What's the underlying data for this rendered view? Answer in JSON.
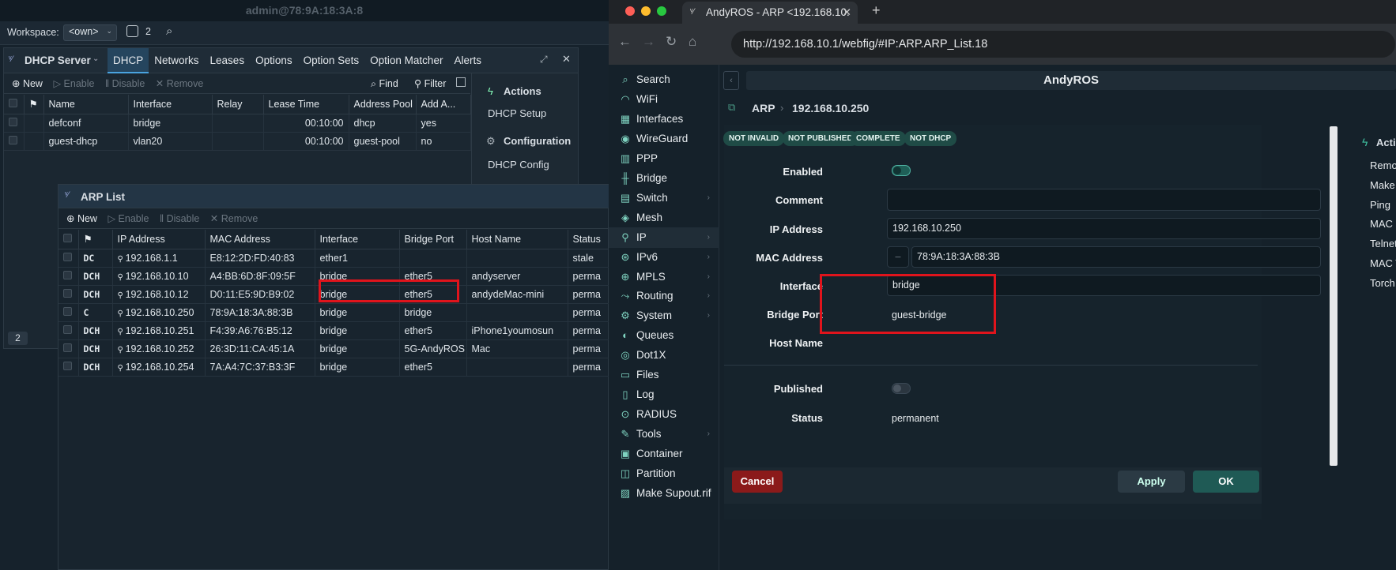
{
  "winbox": {
    "title": "admin@78:9A:18:3A:8",
    "workspace_label": "Workspace:",
    "workspace_value": "<own>",
    "window_count": "2"
  },
  "dhcp": {
    "title": "DHCP Server",
    "tabs": [
      "DHCP",
      "Networks",
      "Leases",
      "Options",
      "Option Sets",
      "Option Matcher",
      "Alerts"
    ],
    "toolbar": {
      "new": "New",
      "enable": "Enable",
      "disable": "Disable",
      "remove": "Remove",
      "find": "Find",
      "filter": "Filter"
    },
    "columns": [
      "Name",
      "Interface",
      "Relay",
      "Lease Time",
      "Address Pool",
      "Add A..."
    ],
    "rows": [
      {
        "name": "defconf",
        "interface": "bridge",
        "relay": "",
        "lease": "00:10:00",
        "pool": "dhcp",
        "add": "yes"
      },
      {
        "name": "guest-dhcp",
        "interface": "vlan20",
        "relay": "",
        "lease": "00:10:00",
        "pool": "guest-pool",
        "add": "no"
      }
    ],
    "actions_title": "Actions",
    "action_setup": "DHCP Setup",
    "config_title": "Configuration",
    "config_item": "DHCP Config",
    "count": "2"
  },
  "arp": {
    "title": "ARP List",
    "toolbar": {
      "new": "New",
      "enable": "Enable",
      "disable": "Disable",
      "remove": "Remove"
    },
    "columns": [
      "IP Address",
      "MAC Address",
      "Interface",
      "Bridge Port",
      "Host Name",
      "Status"
    ],
    "rows": [
      {
        "flags": "DC",
        "ip": "192.168.1.1",
        "mac": "E8:12:2D:FD:40:83",
        "iface": "ether1",
        "port": "",
        "host": "",
        "status": "stale"
      },
      {
        "flags": "DCH",
        "ip": "192.168.10.10",
        "mac": "A4:BB:6D:8F:09:5F",
        "iface": "bridge",
        "port": "ether5",
        "host": "andyserver",
        "status": "perma"
      },
      {
        "flags": "DCH",
        "ip": "192.168.10.12",
        "mac": "D0:11:E5:9D:B9:02",
        "iface": "bridge",
        "port": "ether5",
        "host": "andydeMac-mini",
        "status": "perma"
      },
      {
        "flags": "C",
        "ip": "192.168.10.250",
        "mac": "78:9A:18:3A:88:3B",
        "iface": "bridge",
        "port": "bridge",
        "host": "",
        "status": "perma"
      },
      {
        "flags": "DCH",
        "ip": "192.168.10.251",
        "mac": "F4:39:A6:76:B5:12",
        "iface": "bridge",
        "port": "ether5",
        "host": "iPhone1youmosun",
        "status": "perma"
      },
      {
        "flags": "DCH",
        "ip": "192.168.10.252",
        "mac": "26:3D:11:CA:45:1A",
        "iface": "bridge",
        "port": "5G-AndyROS",
        "host": "Mac",
        "status": "perma"
      },
      {
        "flags": "DCH",
        "ip": "192.168.10.254",
        "mac": "7A:A4:7C:37:B3:3F",
        "iface": "bridge",
        "port": "ether5",
        "host": "",
        "status": "perma"
      }
    ]
  },
  "browser": {
    "tab_title": "AndyROS - ARP <192.168.10.",
    "url": "http://192.168.10.1/webfig/#IP:ARP.ARP_List.18"
  },
  "webfig": {
    "header": "AndyROS",
    "menu": [
      {
        "label": "Search",
        "icon": "search-icon",
        "arrow": false
      },
      {
        "label": "WiFi",
        "icon": "wifi-icon",
        "arrow": false
      },
      {
        "label": "Interfaces",
        "icon": "interfaces-icon",
        "arrow": false
      },
      {
        "label": "WireGuard",
        "icon": "wireguard-icon",
        "arrow": false
      },
      {
        "label": "PPP",
        "icon": "ppp-icon",
        "arrow": false
      },
      {
        "label": "Bridge",
        "icon": "bridge-icon",
        "arrow": false
      },
      {
        "label": "Switch",
        "icon": "switch-icon",
        "arrow": true
      },
      {
        "label": "Mesh",
        "icon": "mesh-icon",
        "arrow": false
      },
      {
        "label": "IP",
        "icon": "ip-icon",
        "arrow": true
      },
      {
        "label": "IPv6",
        "icon": "ipv6-icon",
        "arrow": true
      },
      {
        "label": "MPLS",
        "icon": "mpls-icon",
        "arrow": true
      },
      {
        "label": "Routing",
        "icon": "routing-icon",
        "arrow": true
      },
      {
        "label": "System",
        "icon": "system-icon",
        "arrow": true
      },
      {
        "label": "Queues",
        "icon": "queues-icon",
        "arrow": false
      },
      {
        "label": "Dot1X",
        "icon": "dot1x-icon",
        "arrow": false
      },
      {
        "label": "Files",
        "icon": "files-icon",
        "arrow": false
      },
      {
        "label": "Log",
        "icon": "log-icon",
        "arrow": false
      },
      {
        "label": "RADIUS",
        "icon": "radius-icon",
        "arrow": false
      },
      {
        "label": "Tools",
        "icon": "tools-icon",
        "arrow": true
      },
      {
        "label": "Container",
        "icon": "container-icon",
        "arrow": false
      },
      {
        "label": "Partition",
        "icon": "partition-icon",
        "arrow": false
      },
      {
        "label": "Make Supout.rif",
        "icon": "supout-icon",
        "arrow": false
      }
    ],
    "breadcrumb_section": "ARP",
    "breadcrumb_item": "192.168.10.250",
    "badges": [
      "NOT INVALID",
      "NOT PUBLISHED",
      "COMPLETE",
      "NOT DHCP"
    ],
    "form": {
      "enabled_label": "Enabled",
      "comment_label": "Comment",
      "comment_value": "",
      "ip_label": "IP Address",
      "ip_value": "192.168.10.250",
      "mac_label": "MAC Address",
      "mac_value": "78:9A:18:3A:88:3B",
      "interface_label": "Interface",
      "interface_value": "bridge",
      "bridge_port_label": "Bridge Port",
      "bridge_port_value": "guest-bridge",
      "host_label": "Host Name",
      "published_label": "Published",
      "status_label": "Status",
      "status_value": "permanent"
    },
    "buttons": {
      "cancel": "Cancel",
      "apply": "Apply",
      "ok": "OK"
    },
    "actions": {
      "title": "Actions",
      "items": [
        "Remove",
        "Make Stati",
        "Ping",
        "MAC Ping",
        "Telnet",
        "MAC Telne",
        "Torch"
      ]
    }
  },
  "colors": {
    "accent": "#4aa3df",
    "highlight": "#e0141c",
    "teal": "#2a9d8f",
    "cancel": "#8b1a1a"
  }
}
